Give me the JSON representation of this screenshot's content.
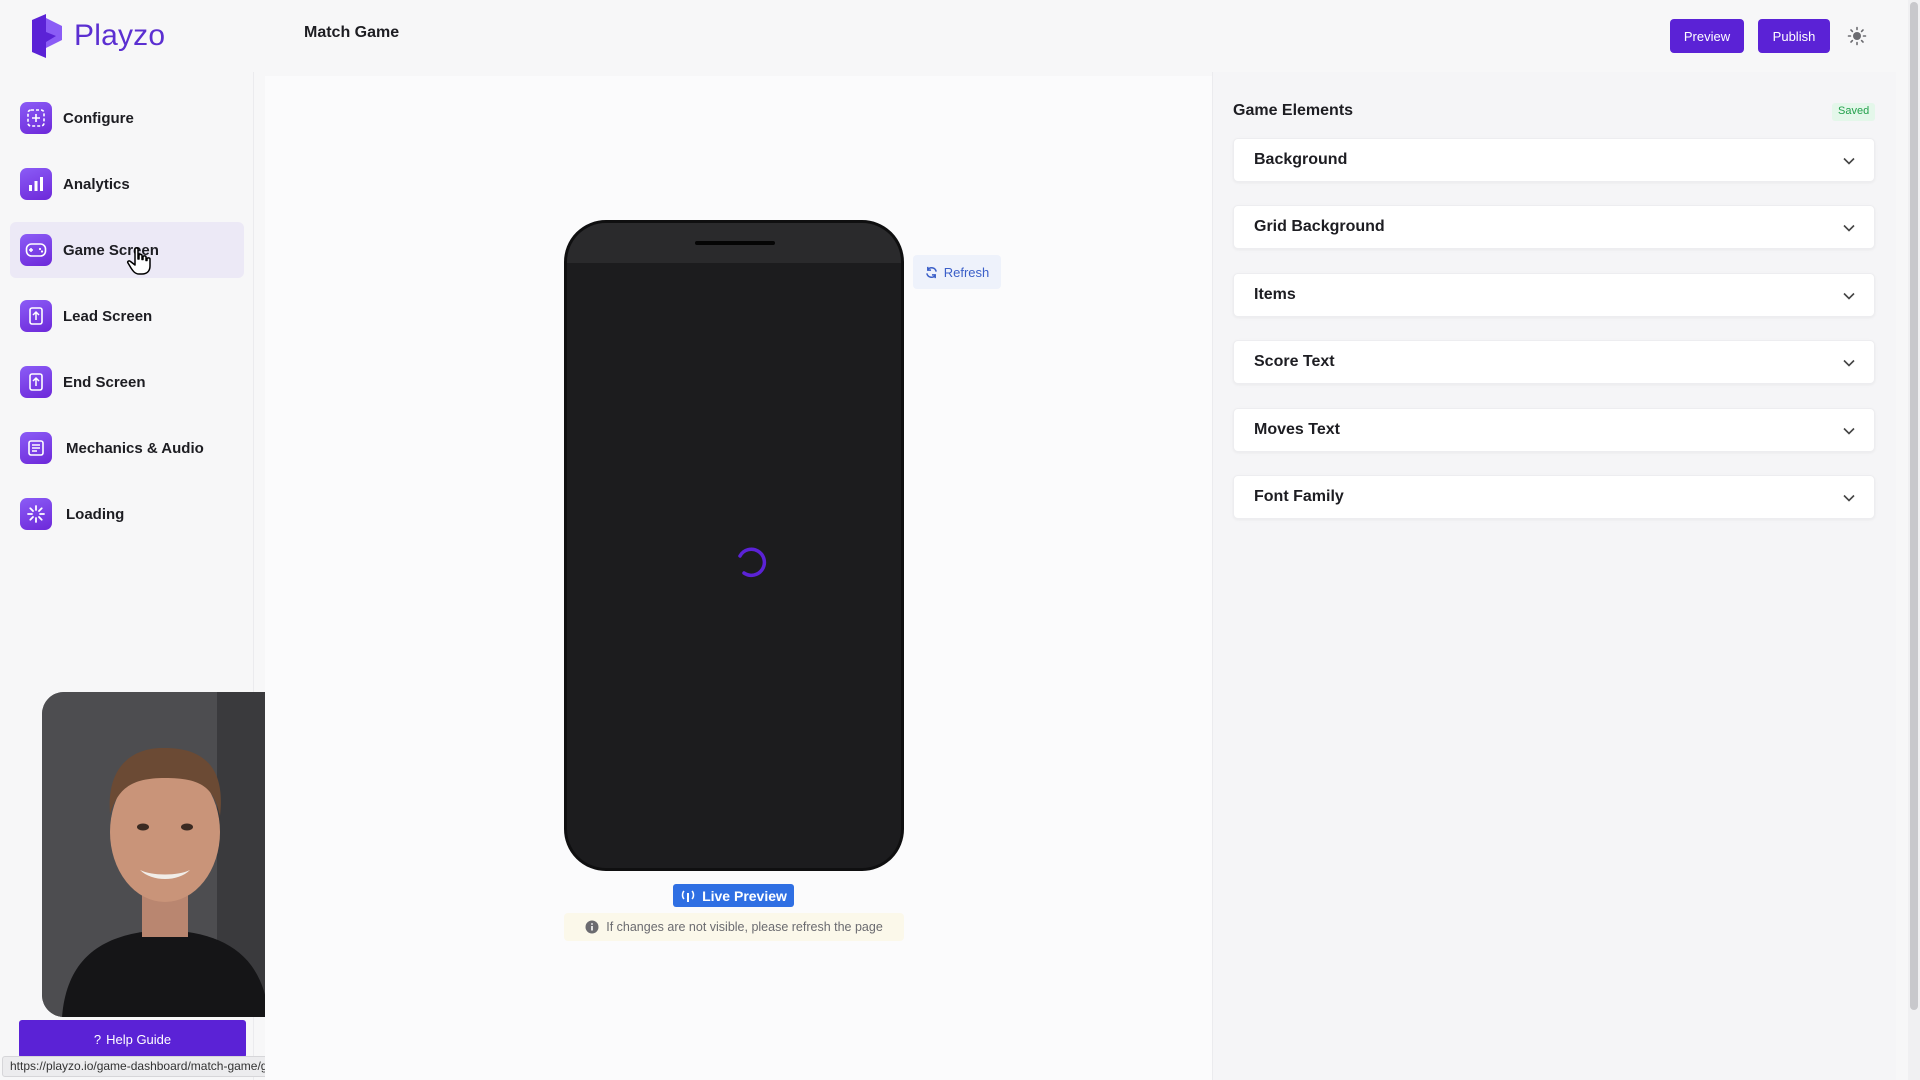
{
  "app": {
    "brand": "Playzo",
    "page_title": "Match Game"
  },
  "toolbar": {
    "preview_label": "Preview",
    "publish_label": "Publish",
    "theme_icon": "sun-icon"
  },
  "sidebar": {
    "items": [
      {
        "label": "Configure",
        "icon": "configure-icon"
      },
      {
        "label": "Analytics",
        "icon": "analytics-icon"
      },
      {
        "label": "Game Screen",
        "icon": "gamepad-icon"
      },
      {
        "label": "Lead Screen",
        "icon": "lead-screen-icon"
      },
      {
        "label": "End Screen",
        "icon": "end-screen-icon"
      },
      {
        "label": "Mechanics & Audio",
        "icon": "mechanics-icon"
      },
      {
        "label": "Loading",
        "icon": "loading-icon"
      }
    ],
    "active_index": 2,
    "help_label": "Help Guide",
    "help_glyph": "?"
  },
  "status_url": "https://playzo.io/game-dashboard/match-game/game-screen/",
  "preview": {
    "refresh_label": "Refresh",
    "live_label": "Live Preview",
    "notice": "If changes are not visible, please refresh the page"
  },
  "panel": {
    "title": "Game Elements",
    "status": "Saved",
    "sections": [
      {
        "label": "Background"
      },
      {
        "label": "Grid Background"
      },
      {
        "label": "Items"
      },
      {
        "label": "Score Text"
      },
      {
        "label": "Moves Text"
      },
      {
        "label": "Font Family"
      }
    ]
  },
  "colors": {
    "accent": "#5b22d6",
    "live_badge": "#2f6fe3",
    "saved": "#22a04b"
  }
}
